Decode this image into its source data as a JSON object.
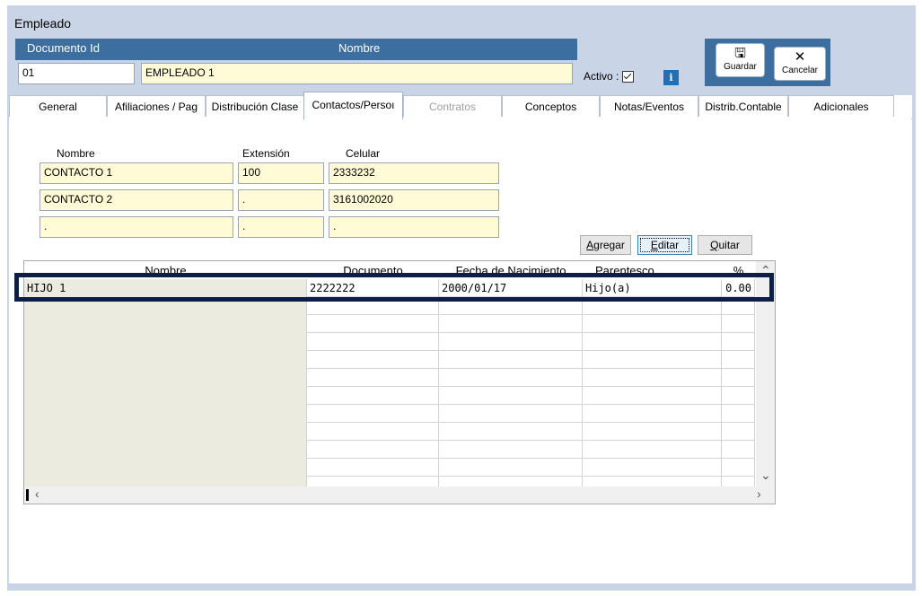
{
  "window": {
    "title": "Empleado"
  },
  "header": {
    "doc_id_label": "Documento Id",
    "name_label": "Nombre",
    "doc_id_value": "01",
    "name_value": "EMPLEADO 1",
    "activo_label": "Activo :",
    "activo_checked": true,
    "info_glyph": "i"
  },
  "toolbar": {
    "save_label": "Guardar",
    "cancel_label": "Cancelar",
    "save_icon": "floppy-disk-icon",
    "cancel_icon": "close-icon"
  },
  "tabs": [
    {
      "label": "General",
      "active": false,
      "disabled": false
    },
    {
      "label": "Afiliaciones / Pag",
      "active": false,
      "disabled": false
    },
    {
      "label": "Distribución Clase",
      "active": false,
      "disabled": false
    },
    {
      "label": "Contactos/Persoı",
      "active": true,
      "disabled": false
    },
    {
      "label": "Contratos",
      "active": false,
      "disabled": true
    },
    {
      "label": "Conceptos",
      "active": false,
      "disabled": false
    },
    {
      "label": "Notas/Eventos",
      "active": false,
      "disabled": false
    },
    {
      "label": "Distrib.Contable",
      "active": false,
      "disabled": false
    },
    {
      "label": "Adicionales",
      "active": false,
      "disabled": false
    }
  ],
  "contacts": {
    "headers": {
      "nombre": "Nombre",
      "extension": "Extensión",
      "celular": "Celular"
    },
    "rows": [
      {
        "nombre": "CONTACTO 1",
        "extension": "100",
        "celular": "2333232"
      },
      {
        "nombre": "CONTACTO 2",
        "extension": ".",
        "celular": "3161002020"
      },
      {
        "nombre": ".",
        "extension": ".",
        "celular": "."
      }
    ]
  },
  "actions": {
    "agregar": "Agregar",
    "editar": "Editar",
    "quitar": "Quitar"
  },
  "grid": {
    "columns": [
      "Nombre",
      "Documento",
      "Fecha de Nacimiento",
      "Parentesco",
      "%"
    ],
    "rows": [
      {
        "nombre": "HIJO 1",
        "documento": "2222222",
        "fecha": "2000/01/17",
        "parentesco": "Hijo(a)",
        "pct": "0.00"
      }
    ]
  }
}
